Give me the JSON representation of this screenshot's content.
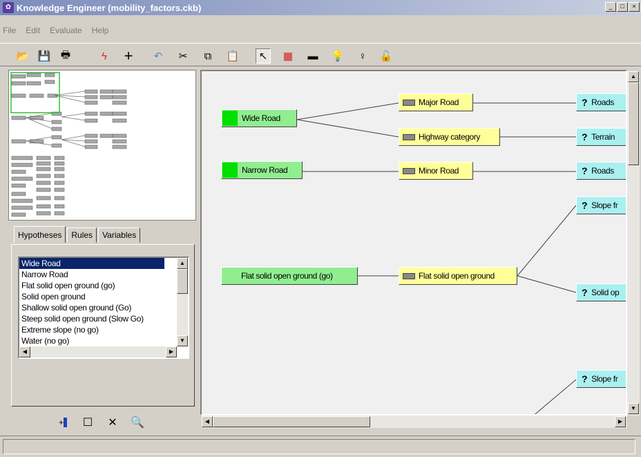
{
  "window": {
    "title": "Knowledge Engineer (mobility_factors.ckb)",
    "min": "_",
    "max": "□",
    "close": "×"
  },
  "menu": [
    "File",
    "Edit",
    "Evaluate",
    "Help"
  ],
  "toolbar_icons": [
    "open-folder-icon",
    "save-disk-icon",
    "print-icon",
    "lightning-icon",
    "plus-icon",
    "undo-icon",
    "scissors-icon",
    "copy-icon",
    "paste-icon",
    "pointer-arrow-icon",
    "variable-grid-icon",
    "rule-bar-icon",
    "lightbulb-icon",
    "lightbulb-off-icon",
    "lock-icon"
  ],
  "tabs": [
    "Hypotheses",
    "Rules",
    "Variables"
  ],
  "hypotheses_list": [
    "Wide Road",
    "Narrow Road",
    "Flat solid open ground (go)",
    "Solid open ground",
    "Shallow solid open ground (Go)",
    "Steep solid open ground (Slow Go)",
    "Extreme slope (no go)",
    "Water (no go)"
  ],
  "selected_index": 0,
  "nodes": {
    "hyp_wide": "Wide Road",
    "hyp_narrow": "Narrow Road",
    "hyp_flat": "Flat solid open ground (go)",
    "rule_major": "Major Road",
    "rule_highway": "Highway category",
    "rule_minor": "Minor Road",
    "rule_flat": "Flat solid open ground",
    "var_roads1": "Roads",
    "var_terrain": "Terrain",
    "var_roads2": "Roads",
    "var_slope1": "Slope fr",
    "var_solid": "Solid op",
    "var_slope2": "Slope fr"
  },
  "qmark": "?",
  "colors": {
    "hypothesis": "#90ee90",
    "rule": "#ffff99",
    "variable": "#aaf0f0",
    "selection": "#0a246a"
  }
}
